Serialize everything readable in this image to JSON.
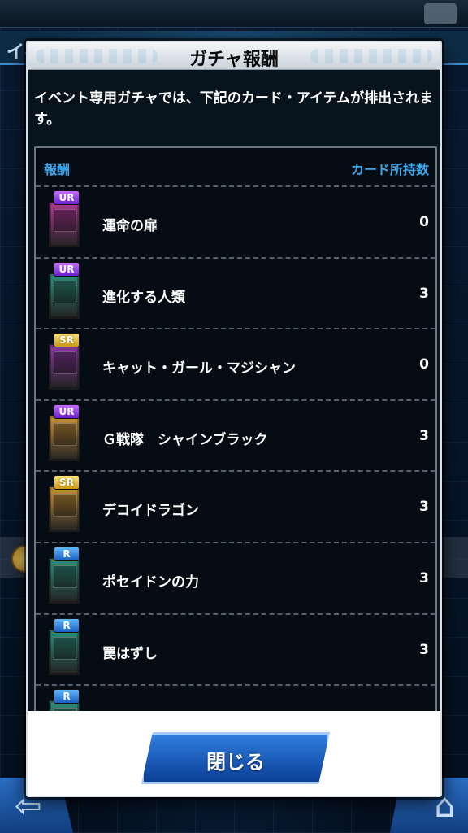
{
  "background": {
    "header_text": "イベ",
    "back_icon": "back-arrow-icon",
    "home_icon": "home-icon"
  },
  "modal": {
    "title": "ガチャ報酬",
    "description": "イベント専用ガチャでは、下記のカード・アイテムが排出されます。",
    "list_header": {
      "reward": "報酬",
      "owned_count": "カード所持数"
    },
    "items": [
      {
        "rarity": "UR",
        "name": "運命の扉",
        "count": "0",
        "card_color": "#b03a9a"
      },
      {
        "rarity": "UR",
        "name": "進化する人類",
        "count": "3",
        "card_color": "#2e8f7a"
      },
      {
        "rarity": "SR",
        "name": "キャット・ガール・マジシャン",
        "count": "0",
        "card_color": "#8a3aa0"
      },
      {
        "rarity": "UR",
        "name": "Ｇ戦隊　シャインブラック",
        "count": "3",
        "card_color": "#c9913a"
      },
      {
        "rarity": "SR",
        "name": "デコイドラゴン",
        "count": "3",
        "card_color": "#c9913a"
      },
      {
        "rarity": "R",
        "name": "ポセイドンの力",
        "count": "3",
        "card_color": "#2e8f7a"
      },
      {
        "rarity": "R",
        "name": "罠はずし",
        "count": "3",
        "card_color": "#2e8f7a"
      },
      {
        "rarity": "R",
        "name": "",
        "count": "",
        "card_color": "#2e8f7a"
      }
    ],
    "close_button": "閉じる"
  },
  "colors": {
    "accent_blue": "#3fa6e8",
    "button_blue": "#2f7ee0",
    "ur_purple": "#8a3aff",
    "sr_gold": "#e0b020",
    "r_blue": "#2a7ae0"
  }
}
